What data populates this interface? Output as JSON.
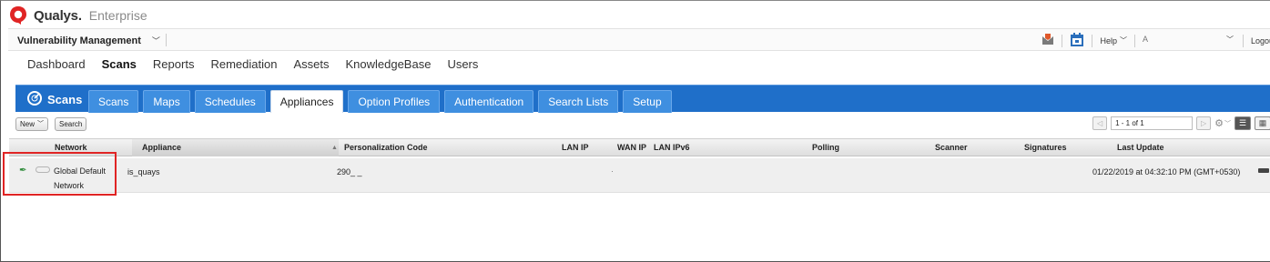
{
  "brand": {
    "name": "Qualys.",
    "edition": "Enterprise",
    "colors": {
      "logo": "#e02424"
    }
  },
  "module_bar": {
    "module": "Vulnerability Management",
    "help": "Help",
    "user": "A",
    "logout": "Logou",
    "icons": [
      "alert-flag-icon",
      "calendar-icon"
    ]
  },
  "main_nav": [
    "Dashboard",
    "Scans",
    "Reports",
    "Remediation",
    "Assets",
    "KnowledgeBase",
    "Users"
  ],
  "main_nav_active": "Scans",
  "scans_tabs": {
    "home_label": "Scans",
    "tabs": [
      "Scans",
      "Maps",
      "Schedules",
      "Appliances",
      "Option Profiles",
      "Authentication",
      "Search Lists",
      "Setup"
    ],
    "active": "Appliances",
    "colors": {
      "band": "#1f6fc9",
      "tab": "#3f8fe0"
    }
  },
  "toolbar": {
    "new_label": "New",
    "search_label": "Search",
    "pager_range": "1 - 1 of 1"
  },
  "table": {
    "headers": {
      "network": "Network",
      "appliance": "Appliance",
      "personalization_code": "Personalization Code",
      "lan_ip": "LAN IP",
      "wan_ip": "WAN IP",
      "lan_ipv6": "LAN IPv6",
      "polling": "Polling",
      "scanner": "Scanner",
      "signatures": "Signatures",
      "last_update": "Last Update"
    },
    "rows": [
      {
        "network_line1": "Global Default",
        "network_line2": "Network",
        "appliance": "is_quays",
        "personalization_code": "290_ _",
        "wan_ip": "·",
        "last_update": "01/22/2019 at 04:32:10 PM (GMT+0530)"
      }
    ]
  }
}
